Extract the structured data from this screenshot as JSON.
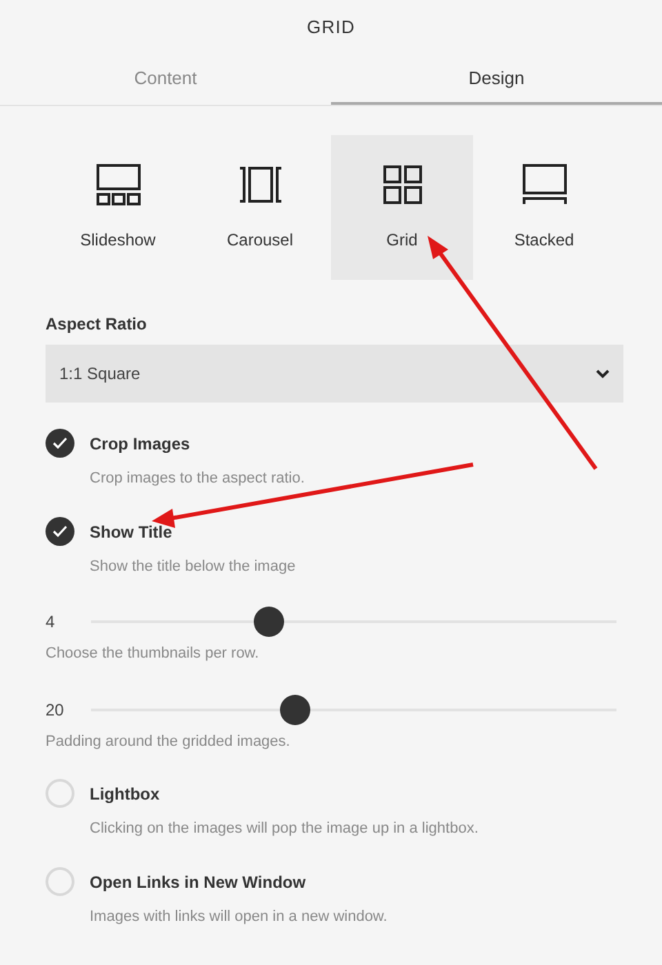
{
  "title": "GRID",
  "tabs": [
    {
      "label": "Content",
      "selected": false
    },
    {
      "label": "Design",
      "selected": true
    }
  ],
  "layouts": [
    {
      "kind": "slideshow",
      "label": "Slideshow",
      "selected": false
    },
    {
      "kind": "carousel",
      "label": "Carousel",
      "selected": false
    },
    {
      "kind": "grid",
      "label": "Grid",
      "selected": true
    },
    {
      "kind": "stacked",
      "label": "Stacked",
      "selected": false
    }
  ],
  "aspect_ratio": {
    "label": "Aspect Ratio",
    "value": "1:1 Square"
  },
  "options": [
    {
      "kind": "checkbox",
      "label": "Crop Images",
      "description": "Crop images to the aspect ratio.",
      "checked": true
    },
    {
      "kind": "checkbox",
      "label": "Show Title",
      "description": "Show the title below the image",
      "checked": true
    },
    {
      "kind": "slider",
      "reading": "4",
      "level": 0.34,
      "description": "Choose the thumbnails per row."
    },
    {
      "kind": "slider",
      "reading": "20",
      "level": 0.39,
      "description": "Padding around the gridded images."
    },
    {
      "kind": "checkbox",
      "label": "Lightbox",
      "description": "Clicking on the images will pop the image up in a lightbox.",
      "checked": false
    },
    {
      "kind": "checkbox",
      "label": "Open Links in New Window",
      "description": "Images with links will open in a new window.",
      "checked": false
    }
  ]
}
